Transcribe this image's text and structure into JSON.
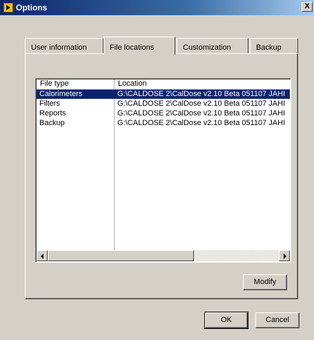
{
  "window": {
    "title": "Options",
    "close_label": "X"
  },
  "tabs": [
    {
      "label": "User information",
      "active": false
    },
    {
      "label": "File locations",
      "active": true
    },
    {
      "label": "Customization",
      "active": false
    },
    {
      "label": "Backup",
      "active": false
    }
  ],
  "list": {
    "columns": [
      "File type",
      "Location"
    ],
    "rows": [
      {
        "type": "Calorimeters",
        "location": "G:\\CALDOSE 2\\CalDose v2.10 Beta 051107 JAHI",
        "selected": true
      },
      {
        "type": "Filters",
        "location": "G:\\CALDOSE 2\\CalDose v2.10 Beta 051107 JAHI",
        "selected": false
      },
      {
        "type": "Reports",
        "location": "G:\\CALDOSE 2\\CalDose v2.10 Beta 051107 JAHI",
        "selected": false
      },
      {
        "type": "Backup",
        "location": "G:\\CALDOSE 2\\CalDose v2.10 Beta 051107 JAHI",
        "selected": false
      }
    ]
  },
  "buttons": {
    "modify": "Modify",
    "ok": "OK",
    "cancel": "Cancel"
  },
  "colors": {
    "titlebar": "#0a246a",
    "selection": "#0a246a",
    "face": "#d4d0c8"
  }
}
